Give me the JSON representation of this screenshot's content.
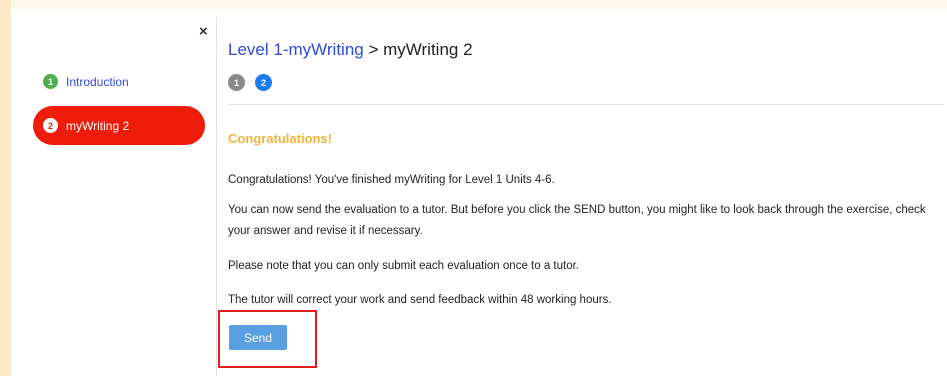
{
  "sidebar": {
    "close_glyph": "×",
    "items": [
      {
        "number": "1",
        "label": "Introduction",
        "active": false
      },
      {
        "number": "2",
        "label": "myWriting 2",
        "active": true
      }
    ]
  },
  "header": {
    "breadcrumb_link": "Level 1-myWriting",
    "breadcrumb_sep": " > ",
    "breadcrumb_current": "myWriting 2",
    "steps": [
      "1",
      "2"
    ]
  },
  "main": {
    "title": "Congratulations!",
    "paragraphs": [
      "Congratulations! You've finished myWriting for Level 1 Units 4-6.",
      "You can now send the evaluation to a tutor. But before you click the SEND button, you might like to look back through the exercise, check your answer and revise it if necessary.",
      "Please note that you can only submit each evaluation once to a tutor.",
      "The tutor will correct your work and send feedback within 48 working hours."
    ],
    "send_label": "Send"
  },
  "colors": {
    "accent_red": "#ee1c0a",
    "link_blue": "#2d4bdc",
    "title_orange": "#f3b43c",
    "button_blue": "#5aa0e0",
    "highlight_red": "#e21f1f"
  }
}
